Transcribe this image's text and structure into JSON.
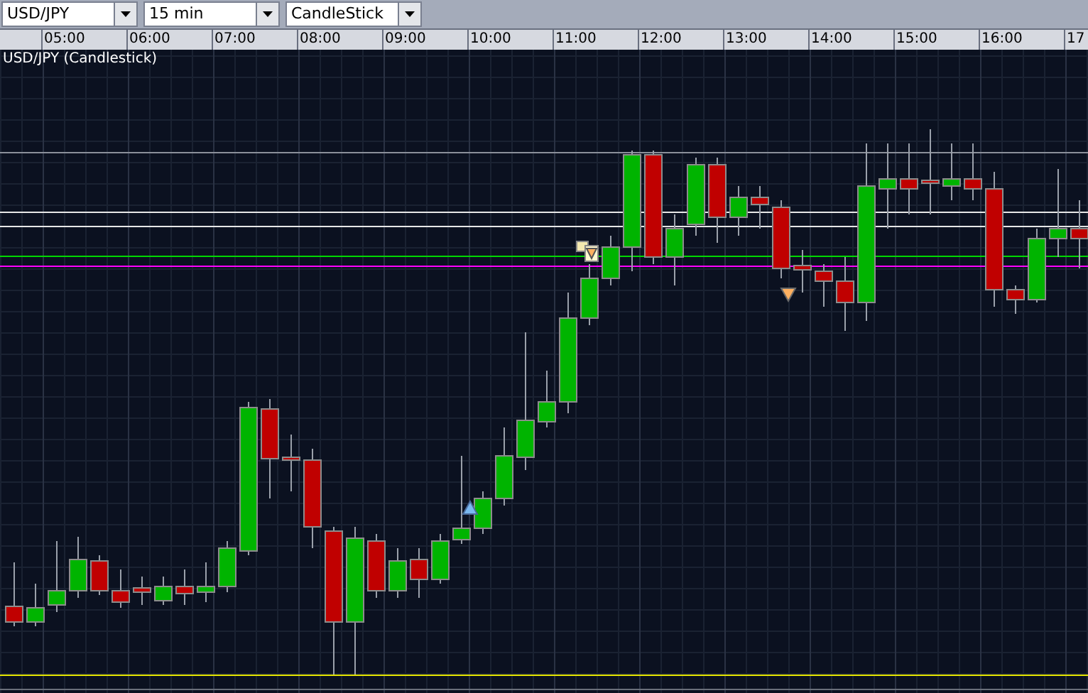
{
  "toolbar": {
    "dropdowns": [
      {
        "value": "USD/JPY"
      },
      {
        "value": "15 min"
      },
      {
        "value": "CandleStick"
      }
    ]
  },
  "time_axis": {
    "labels": [
      "05:00",
      "06:00",
      "07:00",
      "08:00",
      "09:00",
      "10:00",
      "11:00",
      "12:00",
      "13:00",
      "14:00",
      "15:00",
      "16:00",
      "17"
    ]
  },
  "chart": {
    "title": "USD/JPY (Candlestick)"
  }
}
